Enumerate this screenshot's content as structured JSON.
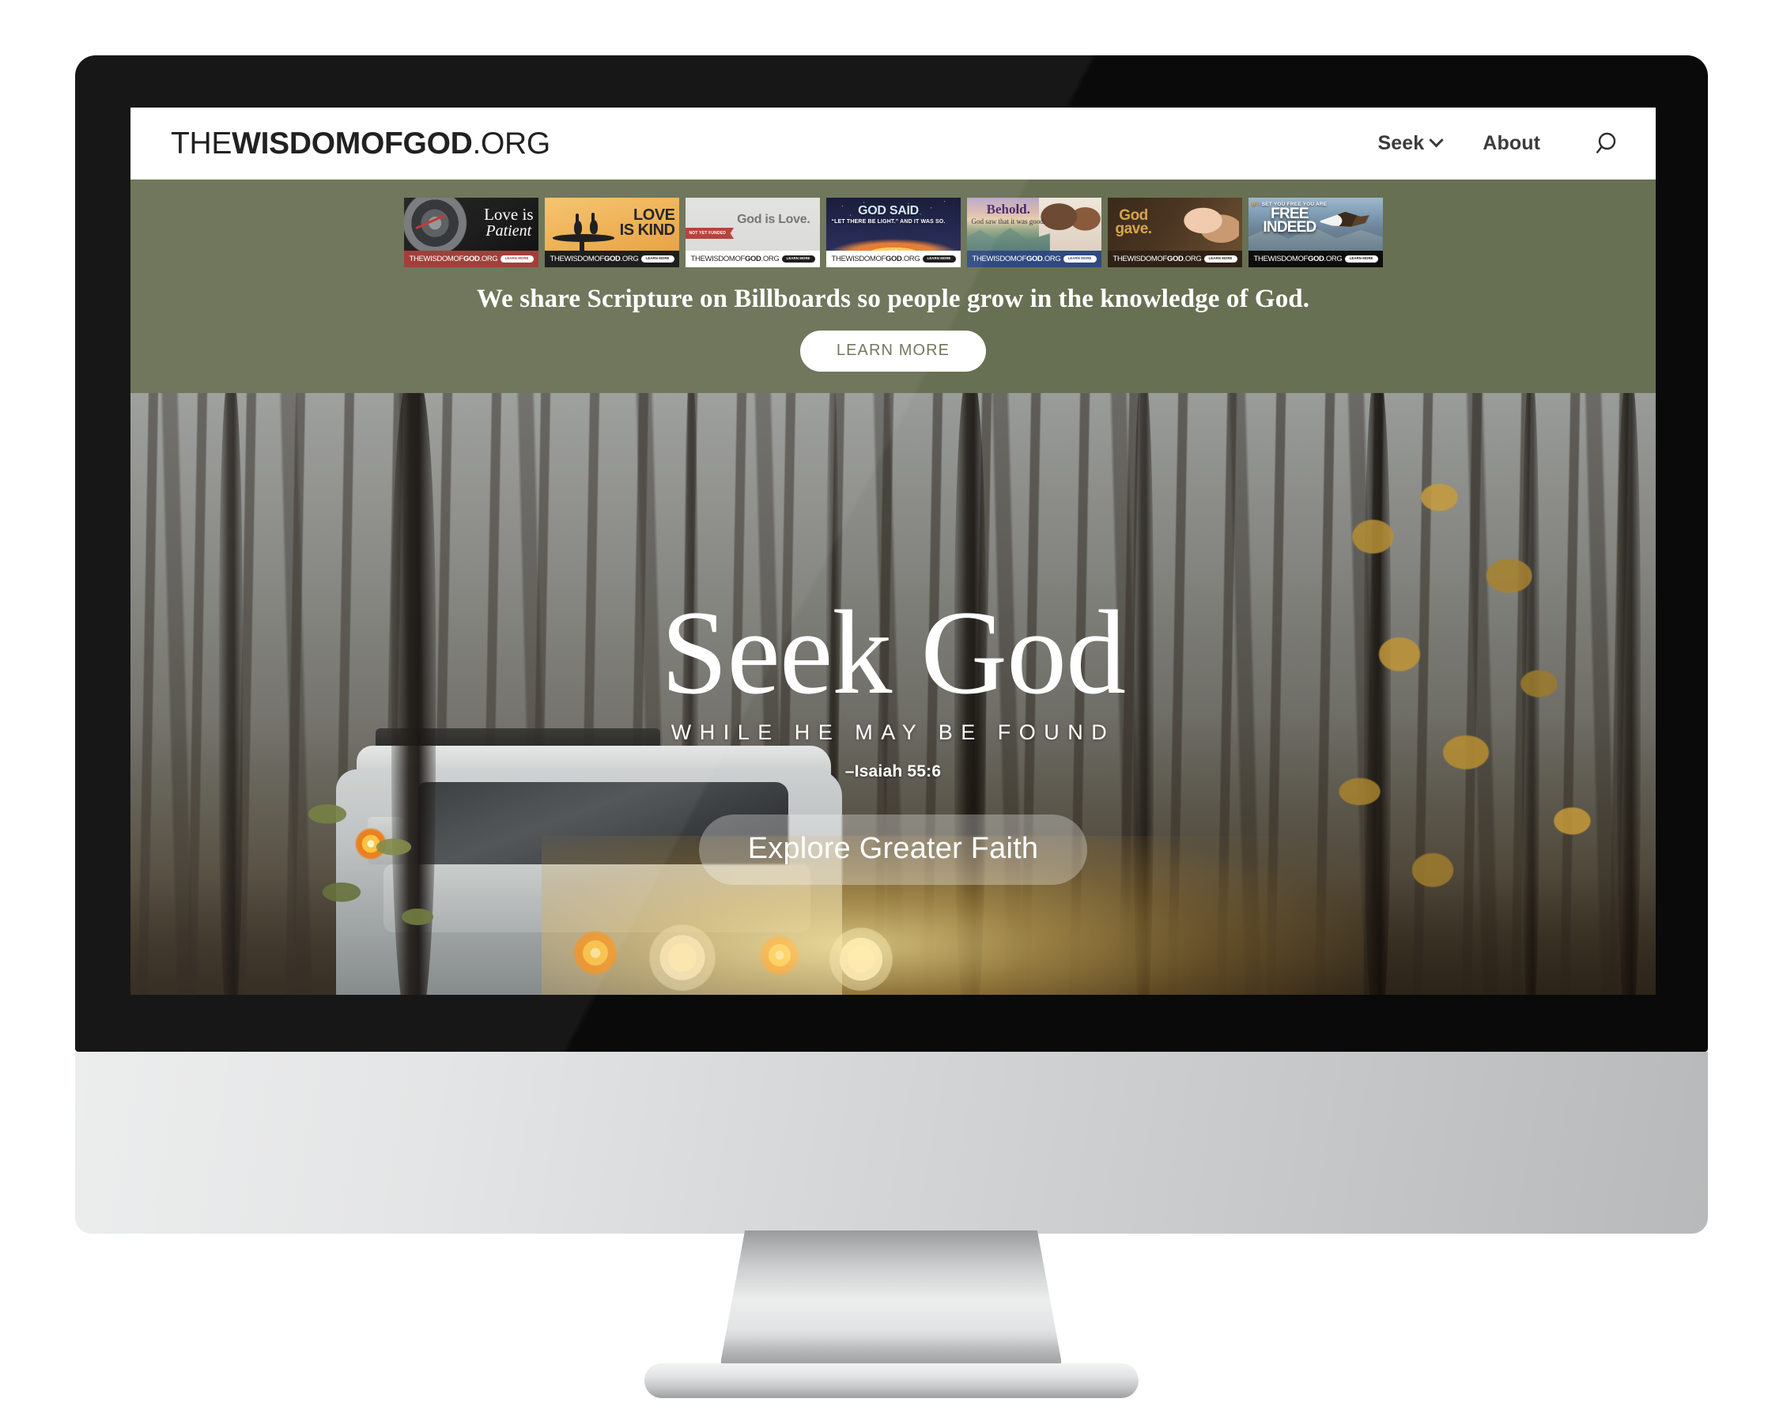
{
  "page": {
    "background_color": "#ffffff",
    "device": "desktop-monitor-mockup"
  },
  "site": {
    "logo": {
      "part_the": "THE",
      "part_wisdom": "WISDOM",
      "part_of": "OF",
      "part_god": "GOD",
      "part_tld": ".ORG",
      "full_text": "THEWISDOMOFGOD.ORG"
    },
    "nav": {
      "items": [
        {
          "label": "Seek",
          "has_dropdown": true
        },
        {
          "label": "About",
          "has_dropdown": false
        }
      ],
      "search_icon": "search-icon"
    }
  },
  "promo": {
    "background_color": "#687053",
    "tagline": "We share Scripture on Billboards so people grow in the knowledge of God.",
    "cta_label": "LEARN MORE",
    "cta_text_color": "#6a7255",
    "billboards": [
      {
        "headline_line1": "Love is",
        "headline_line2": "Patient",
        "site_light": "THEWISDOMOF",
        "site_bold": "GOD",
        "site_tail": ".ORG",
        "pill_label": "LEARN MORE",
        "footer_color": "#9e3430",
        "theme": "watch-black"
      },
      {
        "headline_line1": "LOVE",
        "headline_line2": "IS KIND",
        "site_light": "THEWISDOMOF",
        "site_bold": "GOD",
        "site_tail": ".ORG",
        "pill_label": "LEARN MORE",
        "footer_color": "#111111",
        "theme": "storks-orange"
      },
      {
        "headline_line1": "God is Love.",
        "ribbon_label": "NOT YET FUNDED",
        "site_light": "THEWISDOMOF",
        "site_bold": "GOD",
        "site_tail": ".ORG",
        "pill_label": "LEARN MORE",
        "footer_color": "#ffffff",
        "theme": "gray-plain"
      },
      {
        "headline_line1": "GOD SAID",
        "headline_line2": "“LET THERE BE LIGHT.” AND IT WAS SO.",
        "site_light": "THEWISDOMOF",
        "site_bold": "GOD",
        "site_tail": ".ORG",
        "pill_label": "LEARN MORE",
        "footer_color": "#ffffff",
        "theme": "space-earth"
      },
      {
        "headline_line1": "Behold.",
        "headline_line2": "God saw that it was good.",
        "site_light": "THEWISDOMOF",
        "site_bold": "GOD",
        "site_tail": ".ORG",
        "pill_label": "LEARN MORE",
        "footer_color": "#2f4a80",
        "theme": "couple-mountains"
      },
      {
        "headline_line1": "God",
        "headline_line2": "gave.",
        "site_light": "THEWISDOMOF",
        "site_bold": "GOD",
        "site_tail": ".ORG",
        "pill_label": "LEARN MORE",
        "footer_color": "#2e2115",
        "theme": "hands-brown"
      },
      {
        "kicker_yellow": "IF I",
        "kicker_white": "SET YOU FREE YOU ARE",
        "headline_line1": "FREE",
        "headline_line2": "INDEED",
        "site_light": "THEWISDOMOF",
        "site_bold": "GOD",
        "site_tail": ".ORG",
        "pill_label": "LEARN MORE",
        "footer_color": "#0d0d0d",
        "theme": "eagle-mountains"
      }
    ]
  },
  "hero": {
    "title": "Seek God",
    "subtitle": "WHILE HE MAY BE FOUND",
    "citation": "–Isaiah 55:6",
    "cta_label": "Explore Greater Faith",
    "image_description": "foggy autumn forest with a silver SUV, headlights on"
  }
}
